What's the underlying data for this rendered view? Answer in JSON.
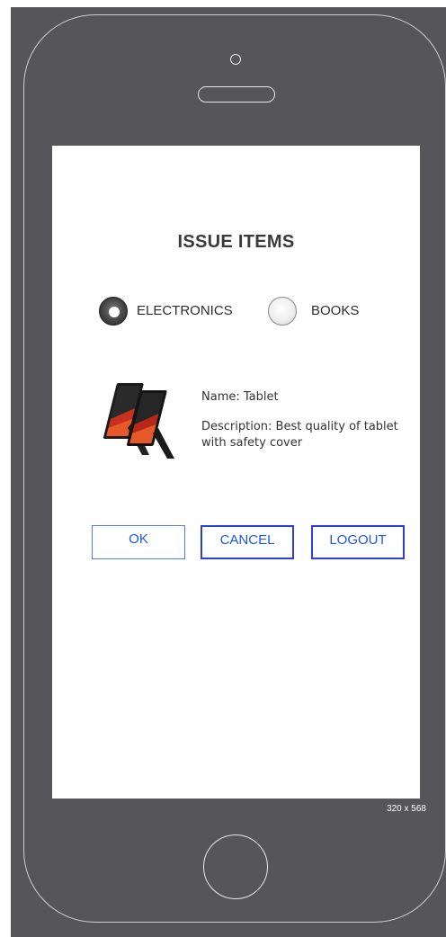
{
  "page": {
    "title": "ISSUE ITEMS",
    "resolution_label": "320 x 568"
  },
  "category": {
    "options": [
      {
        "label": "ELECTRONICS",
        "selected": true
      },
      {
        "label": "BOOKS",
        "selected": false
      }
    ]
  },
  "item": {
    "name": "Name: Tablet",
    "description": "Description: Best quality of tablet with safety cover",
    "image_icon": "tablet-icon"
  },
  "actions": {
    "ok_label": "OK",
    "cancel_label": "CANCEL",
    "logout_label": "LOGOUT"
  },
  "colors": {
    "device_body": "#56555a",
    "button_text": "#1c57e6",
    "button_border": "#2b3fd6"
  }
}
